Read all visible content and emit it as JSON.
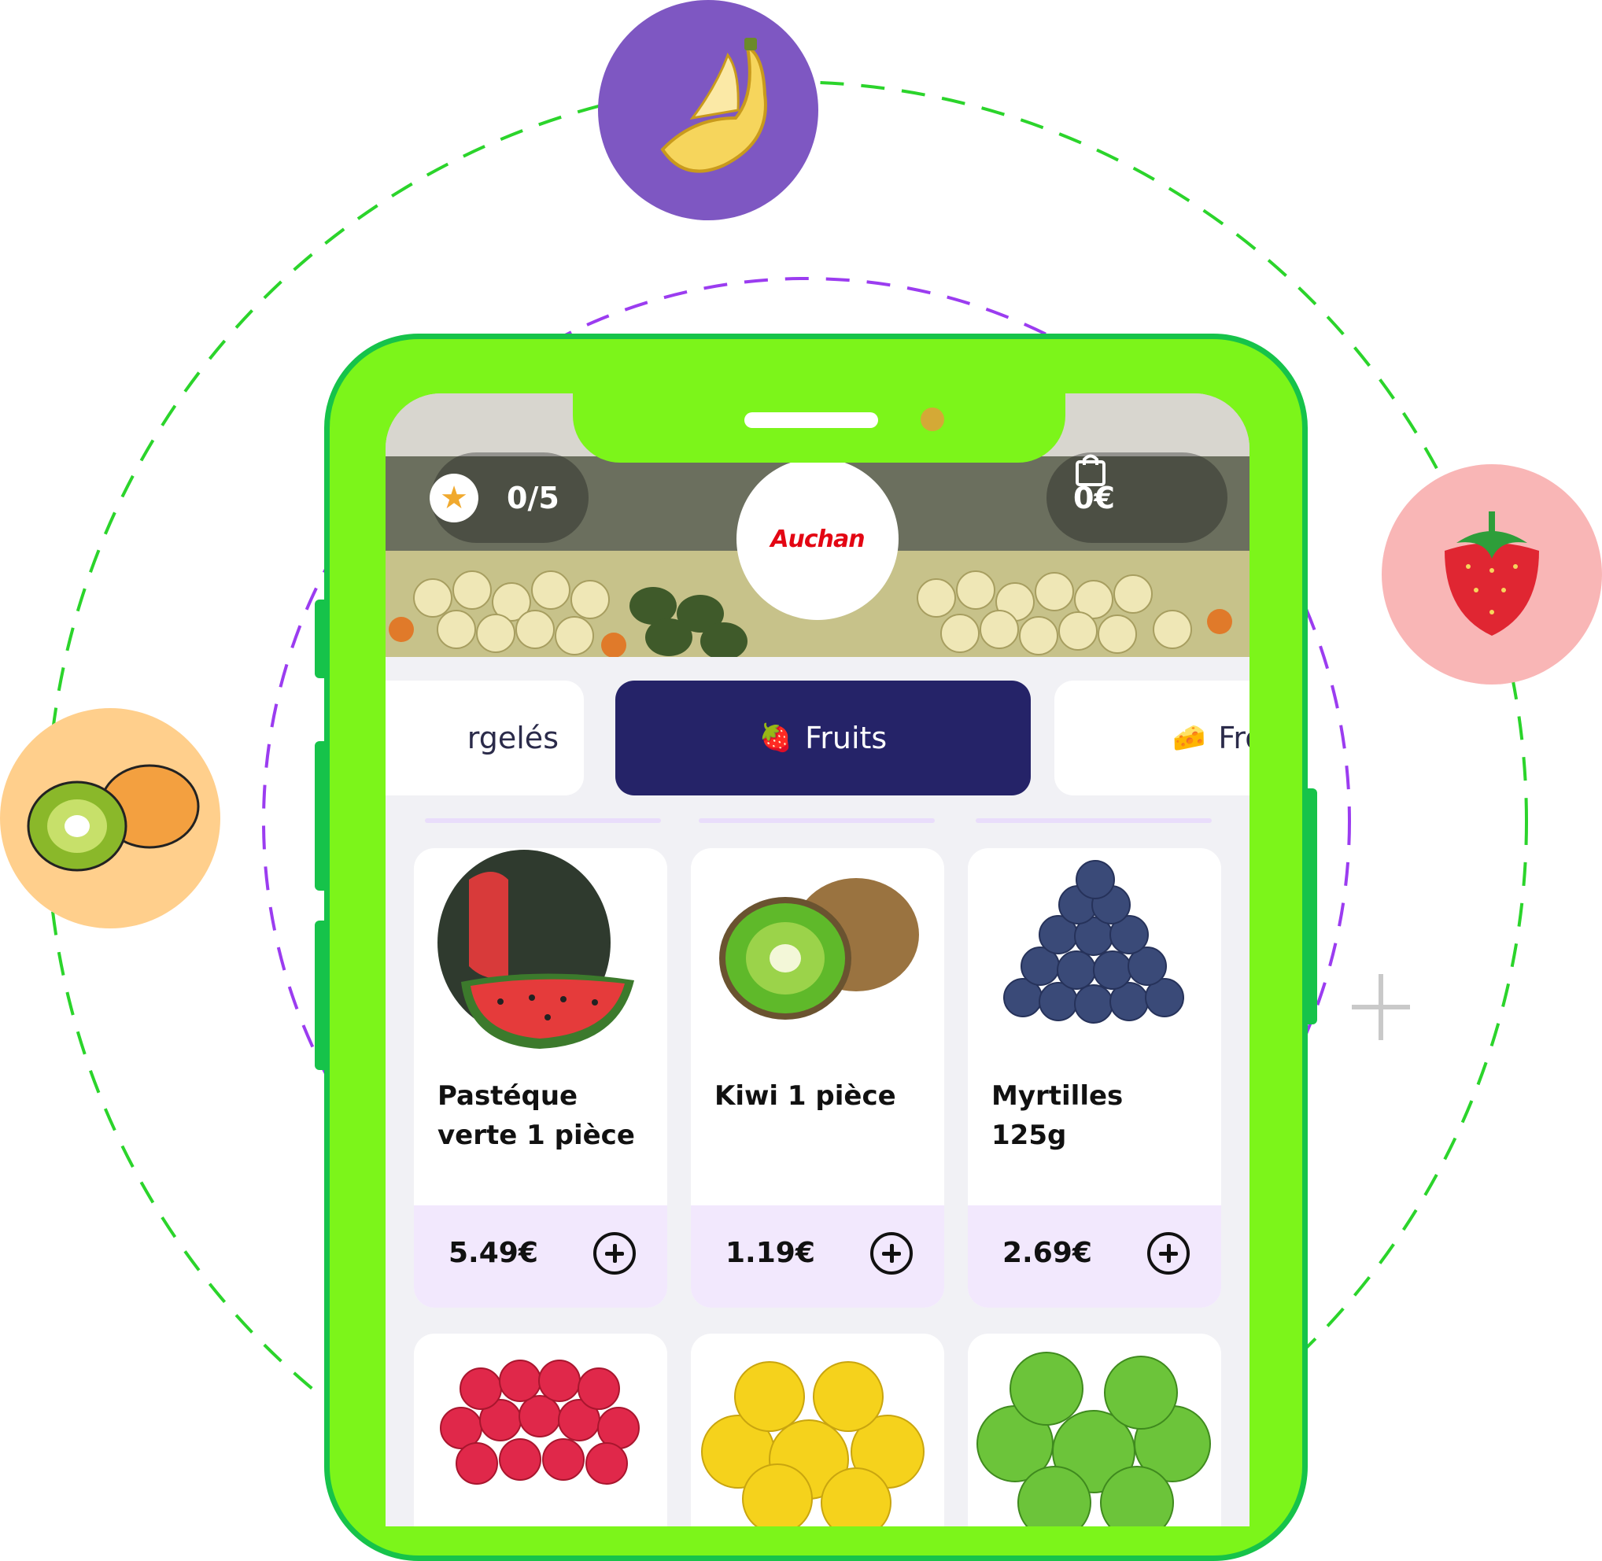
{
  "header": {
    "rating": "0/5",
    "cart_total": "0€",
    "store_name": "Auchan"
  },
  "tabs": [
    {
      "label": "Surgelés",
      "visible_text": "rgelés",
      "emoji": "",
      "active": false
    },
    {
      "label": "Fruits",
      "emoji": "🍓",
      "active": true
    },
    {
      "label": "Fromages",
      "visible_text": "Fro",
      "emoji": "🧀",
      "active": false
    }
  ],
  "products": [
    {
      "name": "Pastéque verte 1 pièce",
      "price": "5.49€",
      "image": "watermelon"
    },
    {
      "name": "Kiwi 1 pièce",
      "price": "1.19€",
      "image": "kiwi"
    },
    {
      "name": "Myrtilles 125g",
      "price": "2.69€",
      "image": "blueberries"
    },
    {
      "name": "",
      "price": "",
      "image": "raspberries"
    },
    {
      "name": "",
      "price": "",
      "image": "yellow-apples"
    },
    {
      "name": "",
      "price": "",
      "image": "green-apples"
    }
  ],
  "decor": {
    "bubbles": [
      "banana-icon",
      "strawberry-icon",
      "kiwi-icon"
    ],
    "colors": {
      "phone": "#7cf51a",
      "phone_border": "#16c34a",
      "active_tab": "#252368",
      "price_bar": "#f2e8fd",
      "orbit_green": "#2bd42b",
      "orbit_purple": "#9b3cf0"
    }
  }
}
